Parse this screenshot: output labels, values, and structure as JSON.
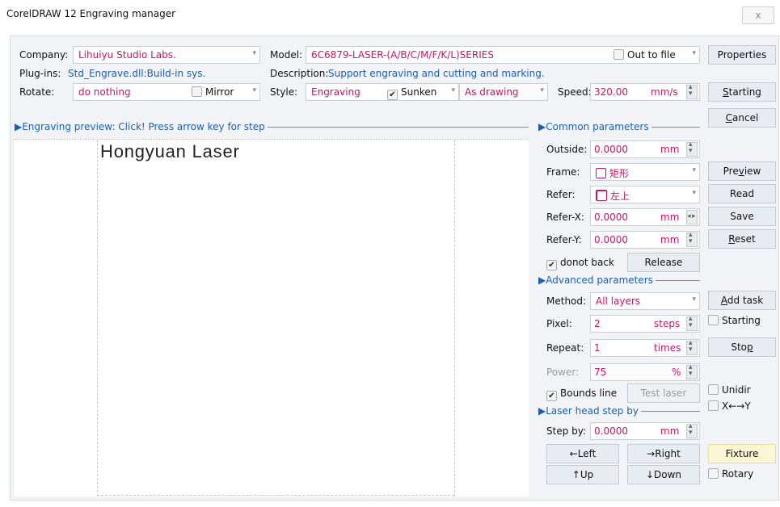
{
  "window": {
    "title": "CorelDRAW 12 Engraving manager",
    "close_label": "x"
  },
  "top": {
    "company_label": "Company:",
    "company_value": "Lihuiyu Studio Labs.",
    "model_label": "Model:",
    "model_value": "6C6879-LASER-(A/B/C/M/F/K/L)SERIES",
    "out_to_file_label": "Out to file",
    "plugins_label": "Plug-ins:",
    "plugins_value": "Std_Engrave.dll:Build-in sys.",
    "description_label": "Description:",
    "description_value": "Support engraving and cutting and marking.",
    "rotate_label": "Rotate:",
    "rotate_value": "do nothing",
    "mirror_label": "Mirror",
    "style_label": "Style:",
    "style_value": "Engraving",
    "sunken_label": "Sunken",
    "as_drawing_value": "As drawing",
    "speed_label": "Speed:",
    "speed_value": "320.00",
    "speed_unit": "mm/s"
  },
  "buttons": {
    "properties": "Properties",
    "starting": "Starting",
    "cancel": "Cancel",
    "preview": "Preview",
    "read": "Read",
    "save": "Save",
    "reset": "Reset",
    "add_task": "Add task",
    "stop": "Stop",
    "fixture": "Fixture",
    "release": "Release",
    "test_laser": "Test laser",
    "left": "←Left",
    "right": "→Right",
    "up": "↑Up",
    "down": "↓Down"
  },
  "preview": {
    "header": "▶Engraving preview: Click! Press arrow key for step",
    "engrave_text": "Hongyuan Laser"
  },
  "common": {
    "header": "▶Common parameters",
    "outside_label": "Outside:",
    "outside_value": "0.0000",
    "outside_unit": "mm",
    "frame_label": "Frame:",
    "frame_value": "矩形",
    "refer_label": "Refer:",
    "refer_value": "左上",
    "referx_label": "Refer-X:",
    "referx_value": "0.0000",
    "referx_unit": "mm",
    "refery_label": "Refer-Y:",
    "refery_value": "0.0000",
    "refery_unit": "mm",
    "donot_back_label": "donot back"
  },
  "advanced": {
    "header": "▶Advanced parameters",
    "method_label": "Method:",
    "method_value": "All layers",
    "pixel_label": "Pixel:",
    "pixel_value": "2",
    "pixel_unit": "steps",
    "repeat_label": "Repeat:",
    "repeat_value": "1",
    "repeat_unit": "times",
    "power_label": "Power:",
    "power_value": "75",
    "power_unit": "%",
    "bounds_line_label": "Bounds line"
  },
  "laserhead": {
    "header": "▶Laser head step by",
    "stepby_label": "Step by:",
    "stepby_value": "0.0000",
    "stepby_unit": "mm"
  },
  "side_checks": {
    "starting_label": "Starting",
    "unidir_label": "Unidir",
    "xy_label": "X←→Y",
    "rotary_label": "Rotary"
  },
  "checkmark": "✔"
}
